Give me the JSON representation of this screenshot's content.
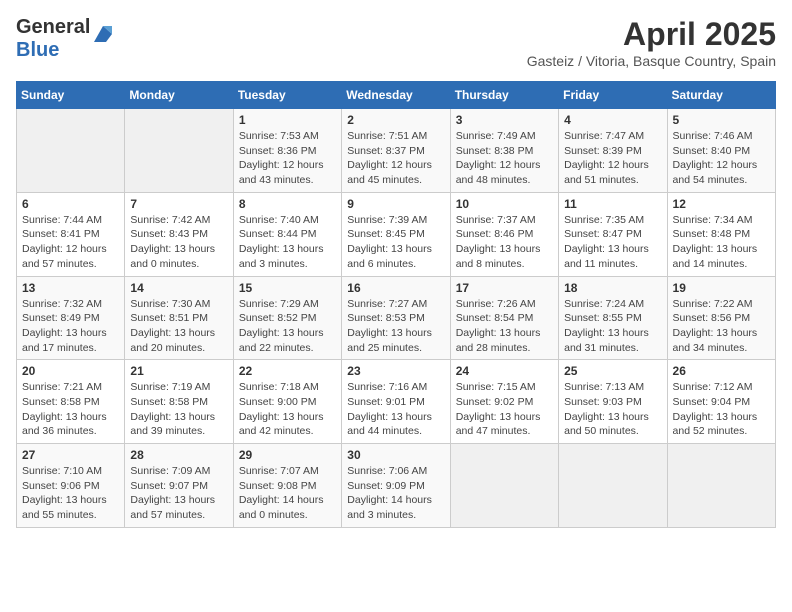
{
  "header": {
    "logo_general": "General",
    "logo_blue": "Blue",
    "title": "April 2025",
    "subtitle": "Gasteiz / Vitoria, Basque Country, Spain"
  },
  "weekdays": [
    "Sunday",
    "Monday",
    "Tuesday",
    "Wednesday",
    "Thursday",
    "Friday",
    "Saturday"
  ],
  "weeks": [
    [
      {
        "day": "",
        "sunrise": "",
        "sunset": "",
        "daylight": ""
      },
      {
        "day": "",
        "sunrise": "",
        "sunset": "",
        "daylight": ""
      },
      {
        "day": "1",
        "sunrise": "Sunrise: 7:53 AM",
        "sunset": "Sunset: 8:36 PM",
        "daylight": "Daylight: 12 hours and 43 minutes."
      },
      {
        "day": "2",
        "sunrise": "Sunrise: 7:51 AM",
        "sunset": "Sunset: 8:37 PM",
        "daylight": "Daylight: 12 hours and 45 minutes."
      },
      {
        "day": "3",
        "sunrise": "Sunrise: 7:49 AM",
        "sunset": "Sunset: 8:38 PM",
        "daylight": "Daylight: 12 hours and 48 minutes."
      },
      {
        "day": "4",
        "sunrise": "Sunrise: 7:47 AM",
        "sunset": "Sunset: 8:39 PM",
        "daylight": "Daylight: 12 hours and 51 minutes."
      },
      {
        "day": "5",
        "sunrise": "Sunrise: 7:46 AM",
        "sunset": "Sunset: 8:40 PM",
        "daylight": "Daylight: 12 hours and 54 minutes."
      }
    ],
    [
      {
        "day": "6",
        "sunrise": "Sunrise: 7:44 AM",
        "sunset": "Sunset: 8:41 PM",
        "daylight": "Daylight: 12 hours and 57 minutes."
      },
      {
        "day": "7",
        "sunrise": "Sunrise: 7:42 AM",
        "sunset": "Sunset: 8:43 PM",
        "daylight": "Daylight: 13 hours and 0 minutes."
      },
      {
        "day": "8",
        "sunrise": "Sunrise: 7:40 AM",
        "sunset": "Sunset: 8:44 PM",
        "daylight": "Daylight: 13 hours and 3 minutes."
      },
      {
        "day": "9",
        "sunrise": "Sunrise: 7:39 AM",
        "sunset": "Sunset: 8:45 PM",
        "daylight": "Daylight: 13 hours and 6 minutes."
      },
      {
        "day": "10",
        "sunrise": "Sunrise: 7:37 AM",
        "sunset": "Sunset: 8:46 PM",
        "daylight": "Daylight: 13 hours and 8 minutes."
      },
      {
        "day": "11",
        "sunrise": "Sunrise: 7:35 AM",
        "sunset": "Sunset: 8:47 PM",
        "daylight": "Daylight: 13 hours and 11 minutes."
      },
      {
        "day": "12",
        "sunrise": "Sunrise: 7:34 AM",
        "sunset": "Sunset: 8:48 PM",
        "daylight": "Daylight: 13 hours and 14 minutes."
      }
    ],
    [
      {
        "day": "13",
        "sunrise": "Sunrise: 7:32 AM",
        "sunset": "Sunset: 8:49 PM",
        "daylight": "Daylight: 13 hours and 17 minutes."
      },
      {
        "day": "14",
        "sunrise": "Sunrise: 7:30 AM",
        "sunset": "Sunset: 8:51 PM",
        "daylight": "Daylight: 13 hours and 20 minutes."
      },
      {
        "day": "15",
        "sunrise": "Sunrise: 7:29 AM",
        "sunset": "Sunset: 8:52 PM",
        "daylight": "Daylight: 13 hours and 22 minutes."
      },
      {
        "day": "16",
        "sunrise": "Sunrise: 7:27 AM",
        "sunset": "Sunset: 8:53 PM",
        "daylight": "Daylight: 13 hours and 25 minutes."
      },
      {
        "day": "17",
        "sunrise": "Sunrise: 7:26 AM",
        "sunset": "Sunset: 8:54 PM",
        "daylight": "Daylight: 13 hours and 28 minutes."
      },
      {
        "day": "18",
        "sunrise": "Sunrise: 7:24 AM",
        "sunset": "Sunset: 8:55 PM",
        "daylight": "Daylight: 13 hours and 31 minutes."
      },
      {
        "day": "19",
        "sunrise": "Sunrise: 7:22 AM",
        "sunset": "Sunset: 8:56 PM",
        "daylight": "Daylight: 13 hours and 34 minutes."
      }
    ],
    [
      {
        "day": "20",
        "sunrise": "Sunrise: 7:21 AM",
        "sunset": "Sunset: 8:58 PM",
        "daylight": "Daylight: 13 hours and 36 minutes."
      },
      {
        "day": "21",
        "sunrise": "Sunrise: 7:19 AM",
        "sunset": "Sunset: 8:58 PM",
        "daylight": "Daylight: 13 hours and 39 minutes."
      },
      {
        "day": "22",
        "sunrise": "Sunrise: 7:18 AM",
        "sunset": "Sunset: 9:00 PM",
        "daylight": "Daylight: 13 hours and 42 minutes."
      },
      {
        "day": "23",
        "sunrise": "Sunrise: 7:16 AM",
        "sunset": "Sunset: 9:01 PM",
        "daylight": "Daylight: 13 hours and 44 minutes."
      },
      {
        "day": "24",
        "sunrise": "Sunrise: 7:15 AM",
        "sunset": "Sunset: 9:02 PM",
        "daylight": "Daylight: 13 hours and 47 minutes."
      },
      {
        "day": "25",
        "sunrise": "Sunrise: 7:13 AM",
        "sunset": "Sunset: 9:03 PM",
        "daylight": "Daylight: 13 hours and 50 minutes."
      },
      {
        "day": "26",
        "sunrise": "Sunrise: 7:12 AM",
        "sunset": "Sunset: 9:04 PM",
        "daylight": "Daylight: 13 hours and 52 minutes."
      }
    ],
    [
      {
        "day": "27",
        "sunrise": "Sunrise: 7:10 AM",
        "sunset": "Sunset: 9:06 PM",
        "daylight": "Daylight: 13 hours and 55 minutes."
      },
      {
        "day": "28",
        "sunrise": "Sunrise: 7:09 AM",
        "sunset": "Sunset: 9:07 PM",
        "daylight": "Daylight: 13 hours and 57 minutes."
      },
      {
        "day": "29",
        "sunrise": "Sunrise: 7:07 AM",
        "sunset": "Sunset: 9:08 PM",
        "daylight": "Daylight: 14 hours and 0 minutes."
      },
      {
        "day": "30",
        "sunrise": "Sunrise: 7:06 AM",
        "sunset": "Sunset: 9:09 PM",
        "daylight": "Daylight: 14 hours and 3 minutes."
      },
      {
        "day": "",
        "sunrise": "",
        "sunset": "",
        "daylight": ""
      },
      {
        "day": "",
        "sunrise": "",
        "sunset": "",
        "daylight": ""
      },
      {
        "day": "",
        "sunrise": "",
        "sunset": "",
        "daylight": ""
      }
    ]
  ]
}
